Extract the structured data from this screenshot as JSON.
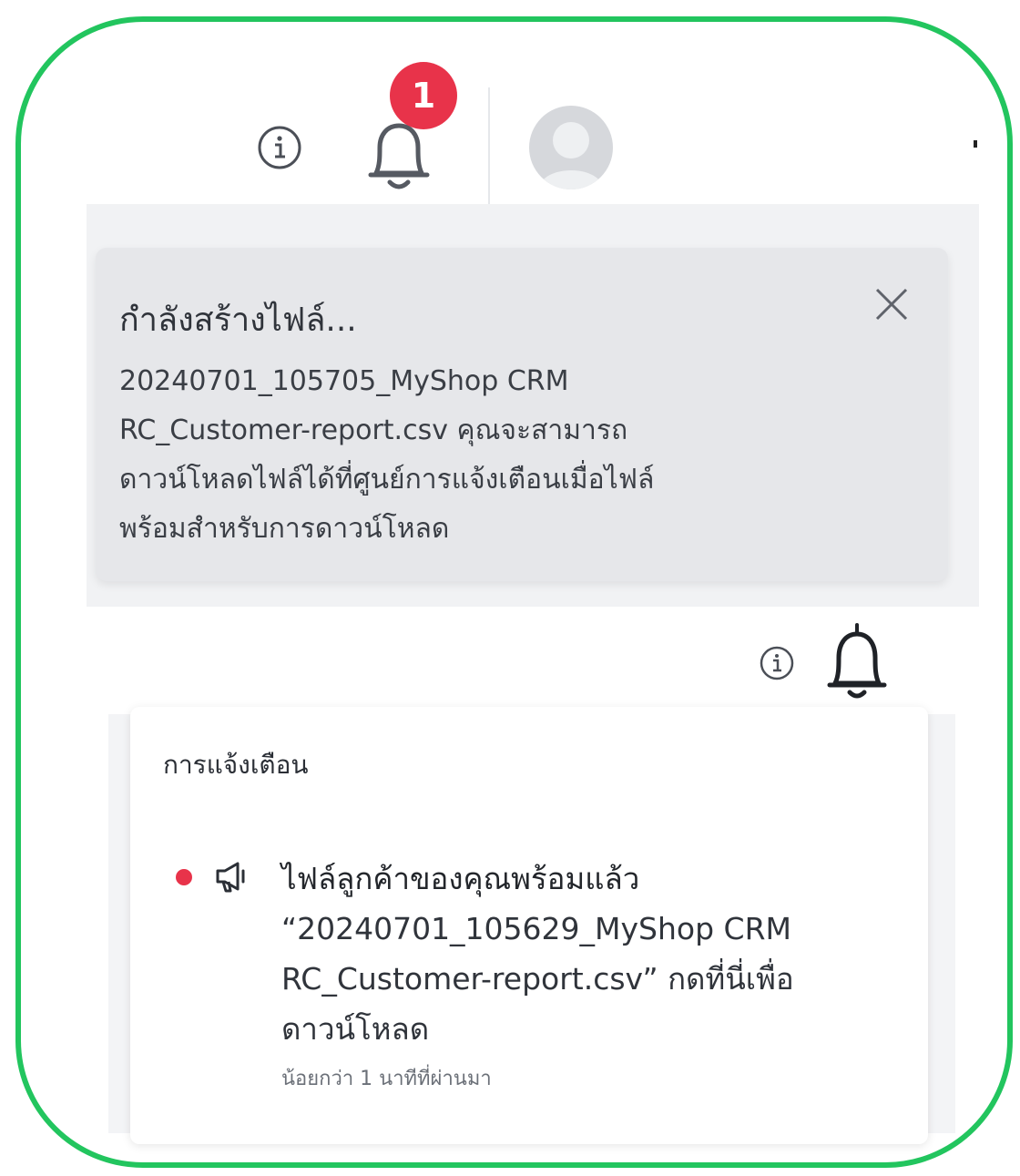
{
  "header": {
    "notification_count": "1",
    "icons": [
      "info-icon",
      "bell-icon",
      "avatar-icon"
    ]
  },
  "toast": {
    "title": "กำลังสร้างไฟล์...",
    "lines": [
      "20240701_105705_MyShop CRM",
      "RC_Customer-report.csv คุณจะสามารถ",
      "ดาวน์โหลดไฟล์ได้ที่ศูนย์การแจ้งเตือนเมื่อไฟล์",
      "พร้อมสำหรับการดาวน์โหลด"
    ],
    "close_icon": "close-icon"
  },
  "notifications": {
    "title": "การแจ้งเตือน",
    "items": [
      {
        "title": "ไฟล์ลูกค้าของคุณพร้อมแล้ว",
        "lines": [
          "“20240701_105629_MyShop CRM",
          "RC_Customer-report.csv” กดที่นี่เพื่อ",
          "ดาวน์โหลด"
        ],
        "time": "น้อยกว่า 1 นาทีที่ผ่านมา",
        "icon": "megaphone-icon",
        "unread": true
      }
    ]
  },
  "colors": {
    "frame": "#22c55e",
    "badge": "#e8334a",
    "unread_dot": "#e8334a",
    "toast_bg": "#e6e7ea"
  }
}
